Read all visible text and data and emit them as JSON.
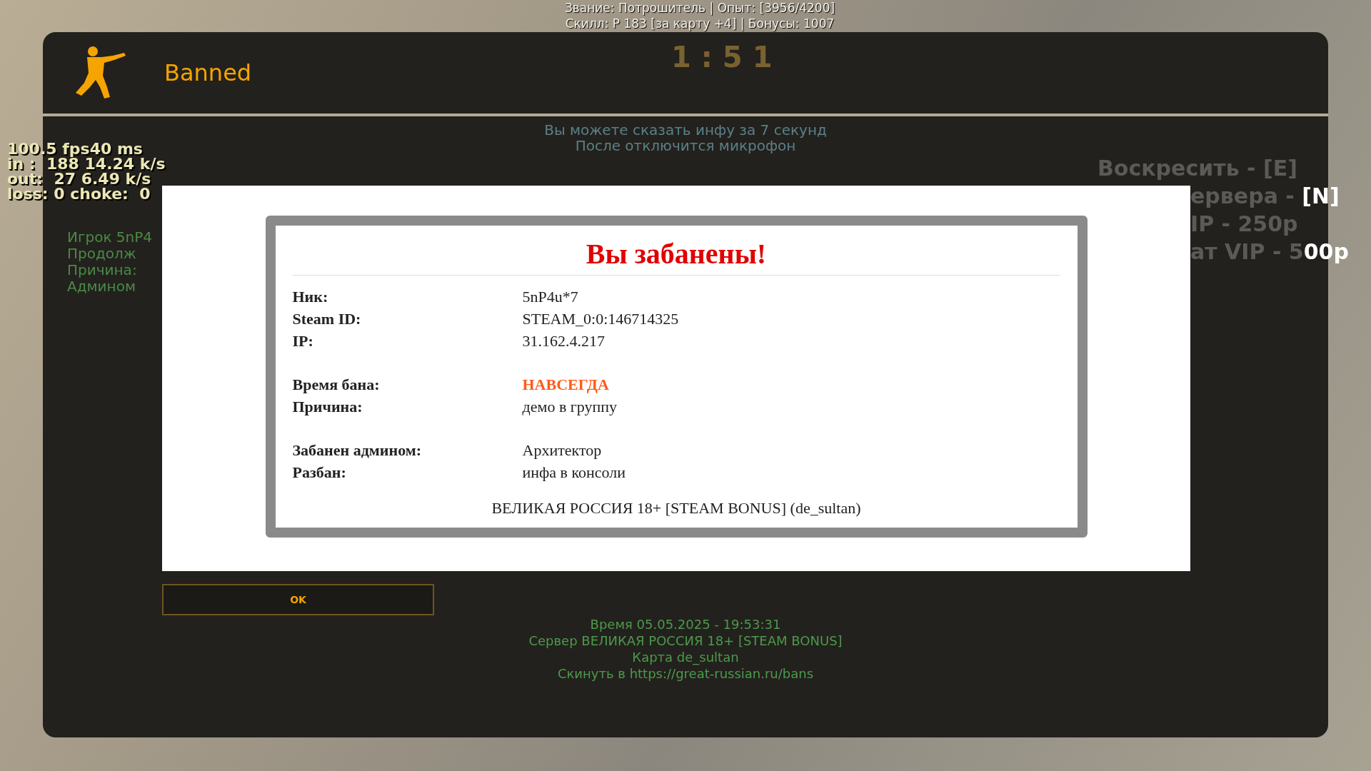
{
  "hud": {
    "rank_lines": [
      "Звание: Потрошитель | Опыт: [3956/4200]",
      "Скилл: Р 183 [за карту +4] | Бонусы: 1007"
    ]
  },
  "netgraph": [
    "100.5 fps40 ms",
    "in :  188 14.24 k/s",
    "out:  27 6.49 k/s",
    "loss: 0 choke:  0"
  ],
  "motd": {
    "title": "Banned",
    "timer": "1:51",
    "notice_lines": [
      "Вы можете сказать инфу за 7 секунд",
      "После отключится микрофон"
    ],
    "side_lines": [
      {
        "text": "Воскресить - [E]"
      },
      {
        "text": "ервера - ",
        "key": "[N]"
      },
      {
        "text": "IP - 250р"
      },
      {
        "text": "ат VIP - 5",
        "key": "00р"
      }
    ],
    "left_lines": [
      "Игрок 5nP4",
      "Продолж",
      "Причина:",
      "Админом"
    ],
    "ban_card": {
      "title": "Вы забанены!",
      "groups": [
        [
          {
            "label": "Ник:",
            "value": "5nP4u*7",
            "emphasis": false
          },
          {
            "label": "Steam ID:",
            "value": "STEAM_0:0:146714325",
            "emphasis": false
          },
          {
            "label": "IP:",
            "value": "31.162.4.217",
            "emphasis": false
          }
        ],
        [
          {
            "label": "Время бана:",
            "value": "НАВСЕГДА",
            "emphasis": true
          },
          {
            "label": "Причина:",
            "value": "демо в группу",
            "emphasis": false
          }
        ],
        [
          {
            "label": "Забанен админом:",
            "value": "Архитектор",
            "emphasis": false
          },
          {
            "label": "Разбан:",
            "value": "инфа в консоли",
            "emphasis": false
          }
        ]
      ],
      "footer": "ВЕЛИКАЯ РОССИЯ 18+ [STEAM BONUS] (de_sultan)"
    },
    "ok_button": "OK",
    "info_lines": [
      "Время 05.05.2025 - 19:53:31",
      "Сервер ВЕЛИКАЯ РОССИЯ 18+ [STEAM BONUS]",
      "Карта de_sultan",
      "Скинуть в https://great-russian.ru/bans"
    ]
  }
}
